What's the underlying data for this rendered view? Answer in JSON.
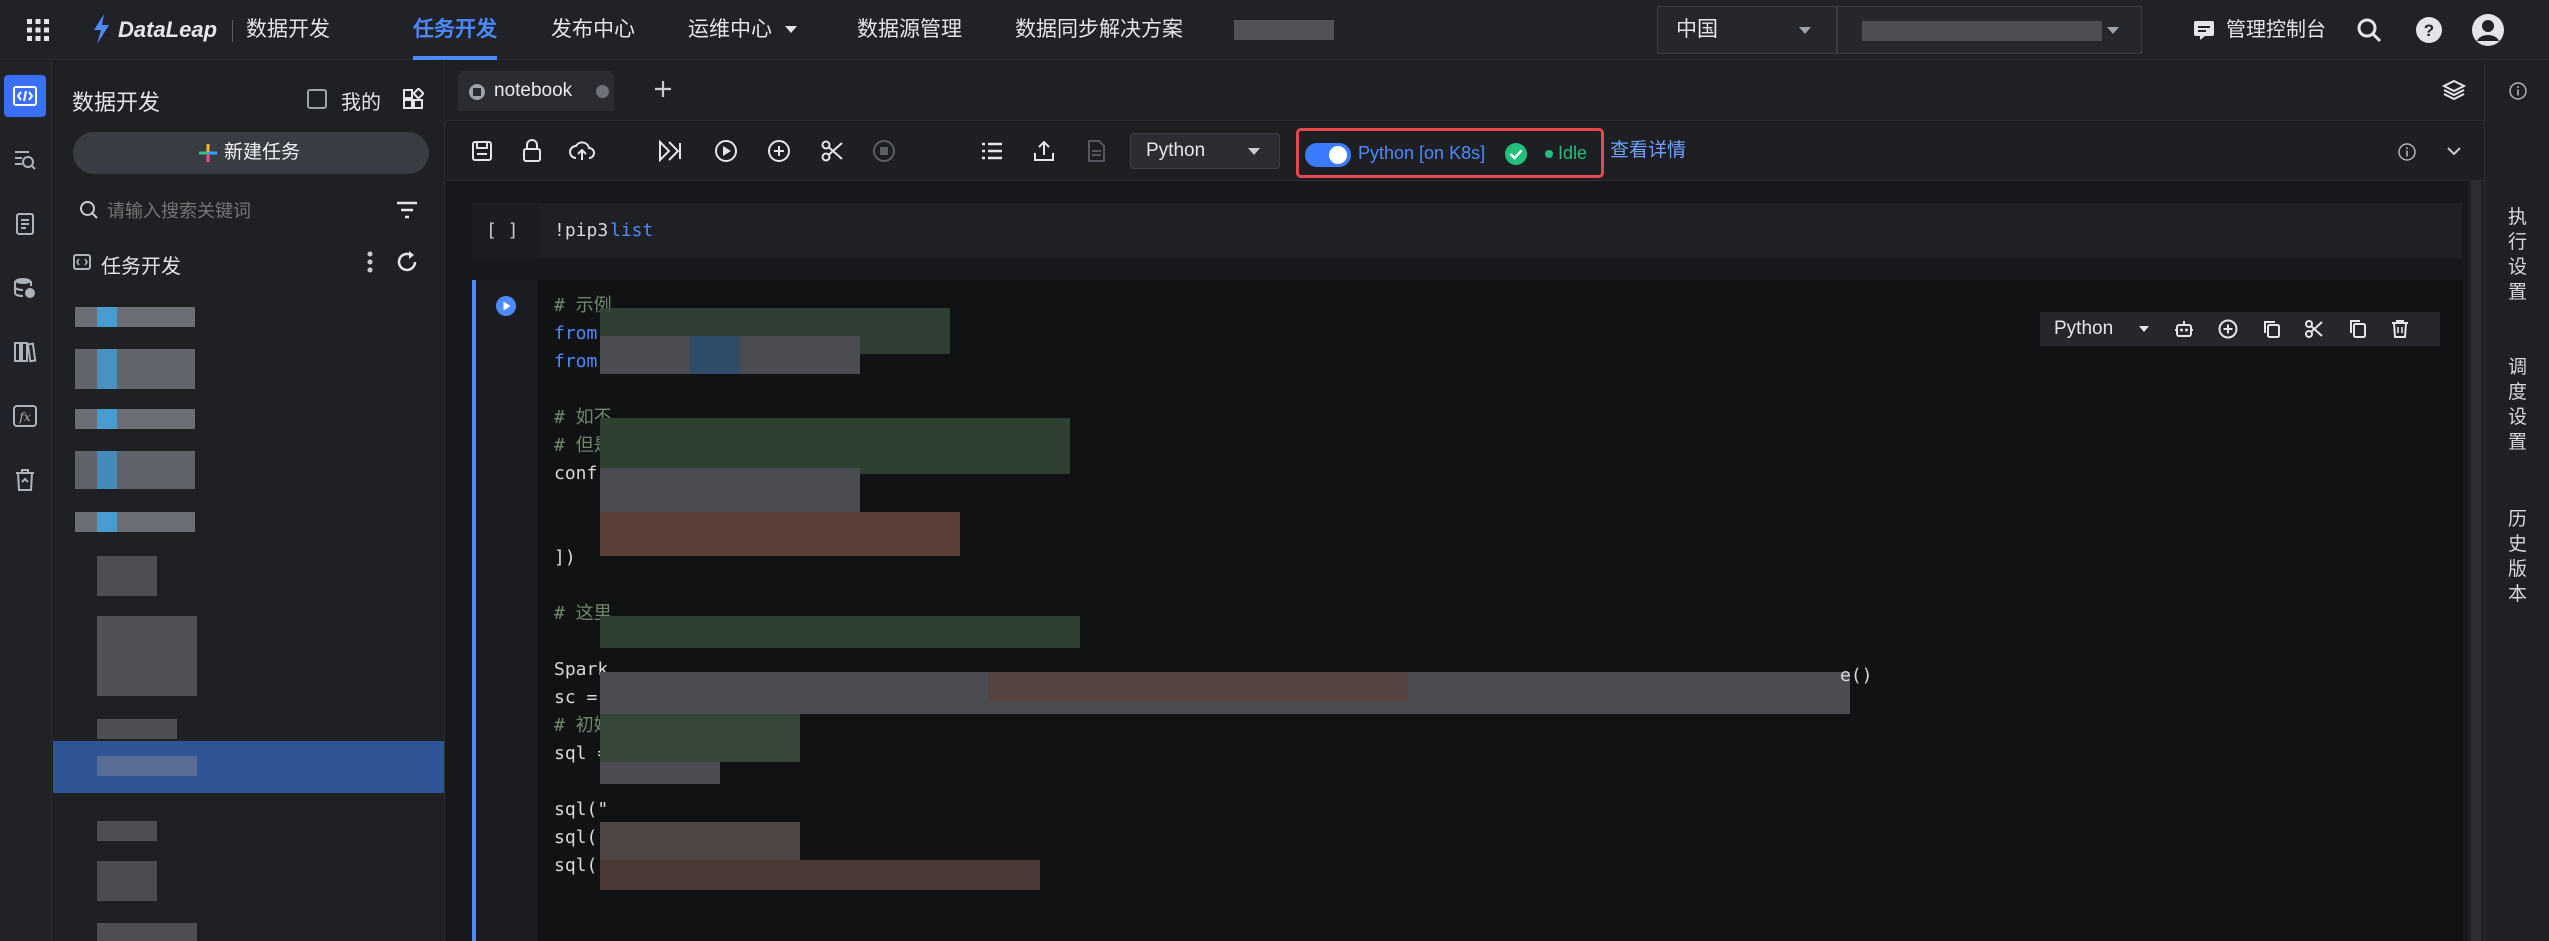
{
  "brand": {
    "logo_text": "DataLeap",
    "product": "数据开发"
  },
  "nav": [
    {
      "label": "任务开发",
      "active": true
    },
    {
      "label": "发布中心",
      "active": false
    },
    {
      "label": "运维中心",
      "active": false
    },
    {
      "label": "数据源管理",
      "active": false
    },
    {
      "label": "数据同步解决方案",
      "active": false
    }
  ],
  "region": {
    "value": "中国"
  },
  "header_right": {
    "console_label": "管理控制台"
  },
  "left_panel": {
    "title": "数据开发",
    "mine_label": "我的",
    "new_task_label": "新建任务",
    "search_placeholder": "请输入搜索关键词",
    "tree_root": "任务开发"
  },
  "tab": {
    "title": "notebook"
  },
  "toolbar": {
    "language": "Python",
    "kernel_label": "Python [on K8s]",
    "status": "Idle",
    "details_link": "查看详情"
  },
  "cell1": {
    "prompt": "[ ]",
    "code_bang": "!pip3 ",
    "code_kw": "list"
  },
  "cell2": {
    "language": "Python",
    "lines": [
      {
        "prefix": "# 示例",
        "kind": "comment"
      },
      {
        "prefix": "from ",
        "kind": "keyword"
      },
      {
        "prefix": "from ",
        "kind": "keyword"
      },
      {
        "prefix": "",
        "kind": "blank"
      },
      {
        "prefix": "# 如不",
        "kind": "comment"
      },
      {
        "prefix": "# 但是",
        "kind": "comment"
      },
      {
        "prefix": "conf =",
        "kind": "plain"
      },
      {
        "prefix": "    (",
        "kind": "plain"
      },
      {
        "prefix": "    (",
        "kind": "plain"
      },
      {
        "prefix": "])",
        "kind": "plain"
      },
      {
        "prefix": "",
        "kind": "blank"
      },
      {
        "prefix": "# 这里",
        "kind": "comment"
      },
      {
        "prefix": "",
        "kind": "blank"
      },
      {
        "prefix": "Spark",
        "kind": "plain"
      },
      {
        "prefix": "sc = ",
        "kind": "plain"
      },
      {
        "prefix": "# 初始",
        "kind": "comment"
      },
      {
        "prefix": "sql =",
        "kind": "plain"
      },
      {
        "prefix": "",
        "kind": "blank"
      },
      {
        "prefix": "sql(\"",
        "kind": "plain"
      },
      {
        "prefix": "sql(\"",
        "kind": "plain"
      },
      {
        "prefix": "sql(\"",
        "kind": "plain"
      }
    ],
    "spark_line_tail": "e()"
  },
  "right_rail": {
    "items": [
      "执行设置",
      "调度设置",
      "历史版本"
    ]
  },
  "colors": {
    "accent": "#4d8bff",
    "success": "#22c07a",
    "highlight_border": "#e5484d",
    "selected_row": "#2f5596"
  }
}
